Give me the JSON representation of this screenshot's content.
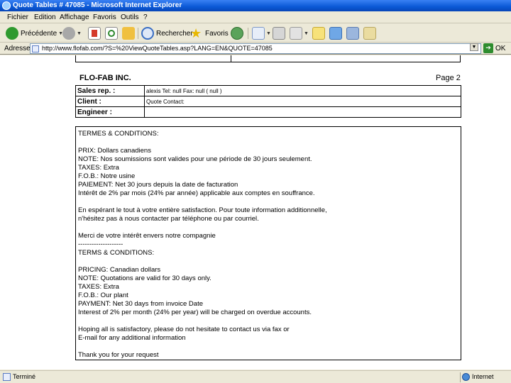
{
  "window": {
    "title": "Quote Tables # 47085 - Microsoft Internet Explorer"
  },
  "menu": {
    "items": [
      "Fichier",
      "Edition",
      "Affichage",
      "Favoris",
      "Outils",
      "?"
    ]
  },
  "toolbar": {
    "back_label": "Précédente",
    "search_label": "Rechercher",
    "favorites_label": "Favoris"
  },
  "address": {
    "label": "Adresse",
    "url": "http://www.flofab.com/?S=%20ViewQuoteTables.asp?LANG=EN&QUOTE=47085",
    "go_label": "OK"
  },
  "document": {
    "company": "FLO-FAB INC.",
    "page": "Page 2",
    "info_rows": [
      {
        "label": "Sales rep. :",
        "value": "alexis Tel: null Fax: null ( null )"
      },
      {
        "label": "Client :",
        "value": "Quote Contact:"
      },
      {
        "label": "Engineer :",
        "value": ""
      }
    ],
    "terms_lines": [
      "TERMES & CONDITIONS:",
      "",
      "PRIX: Dollars canadiens",
      "NOTE: Nos soumissions sont valides pour une période de 30 jours seulement.",
      "TAXES: Extra",
      "F.O.B.: Notre usine",
      "PAIEMENT: Net 30 jours depuis la date de facturation",
      "Intérêt de 2% par mois (24% par année) applicable aux comptes en souffrance.",
      "",
      "En espérant le tout à votre entière satisfaction. Pour toute information additionnelle,",
      "n'hésitez pas à nous contacter par téléphone ou par courriel.",
      "",
      "Merci de votre intérêt envers notre compagnie",
      "--------------------",
      "TERMS & CONDITIONS:",
      "",
      "PRICING: Canadian dollars",
      "NOTE: Quotations are valid for 30 days only.",
      "TAXES: Extra",
      "F.O.B.: Our plant",
      "PAYMENT: Net 30 days from invoice Date",
      "Interest of 2% per month (24% per year) will be charged on overdue accounts.",
      "",
      "Hoping all is satisfactory, please do not hesitate to contact us via fax or",
      "E-mail for any additional information",
      "",
      "Thank you for your request"
    ]
  },
  "status": {
    "text": "Terminé",
    "zone": "Internet"
  }
}
